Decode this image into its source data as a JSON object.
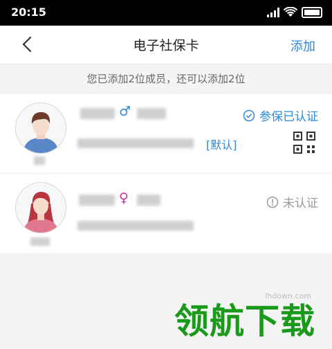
{
  "status_bar": {
    "time": "20:15"
  },
  "nav": {
    "title": "电子社保卡",
    "add_label": "添加"
  },
  "notice": "您已添加2位成员，还可以添加2位",
  "members": [
    {
      "gender_symbol": "♂",
      "status_label": "参保已认证",
      "default_label": "[默认]"
    },
    {
      "gender_symbol": "♀",
      "status_label": "未认证"
    }
  ],
  "watermark": {
    "text": "领航下载",
    "url": "lhdown.com"
  },
  "colors": {
    "accent": "#2f88d8",
    "male": "#2f88d8",
    "female": "#c0359f",
    "watermark": "#1a9a1a"
  }
}
